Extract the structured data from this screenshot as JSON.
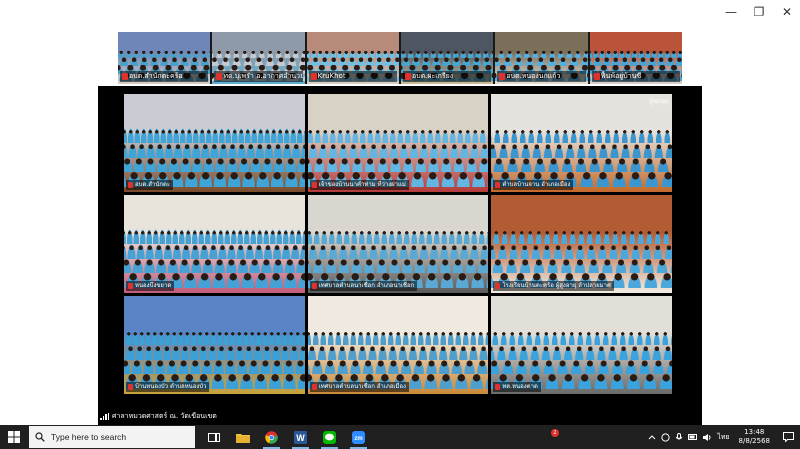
{
  "window": {
    "minimize_glyph": "—",
    "maximize_glyph": "❐",
    "close_glyph": "✕"
  },
  "strip": {
    "thumbs": [
      {
        "name": "อบต.สำนักตะคร้อ",
        "palette": [
          "#6f86b8",
          "#d9d0c4",
          "#4aa0c8"
        ]
      },
      {
        "name": "ทต.บุเพร๋า อ.อากาศอำนวย",
        "palette": [
          "#8f9aa8",
          "#5fb0d5",
          "#c4c9cf"
        ]
      },
      {
        "name": "KruKhot",
        "palette": [
          "#b78a7a",
          "#d8d3c8",
          "#6ec0e4"
        ]
      },
      {
        "name": "อบต.ผะเกรียง",
        "palette": [
          "#4f5663",
          "#cbbf9c",
          "#47a6cf"
        ]
      },
      {
        "name": "อบต.หนองนกแก้ว",
        "palette": [
          "#7b6f5a",
          "#e8e2d6",
          "#54aede"
        ]
      },
      {
        "name": "ฟื้นพ้อยู่บ้านซี",
        "palette": [
          "#b9543a",
          "#d4d4d4",
          "#49a4d4"
        ]
      }
    ]
  },
  "gallery": {
    "corner_label": "ผู้ชุมนุม",
    "tiles": [
      {
        "name": "อบต.สำนักตะ",
        "palette": [
          "#c9ccd2",
          "#7a4b2a",
          "#3fa4d8"
        ]
      },
      {
        "name": "เจ้าของบ้านนาคำท่าม ที่ว่างฝาแม่",
        "palette": [
          "#d8d1c5",
          "#b53a3a",
          "#63b6e2"
        ]
      },
      {
        "name": "ตำบลบ้านจาน อำเภอเมือง",
        "palette": [
          "#e4e2dd",
          "#c3692a",
          "#3b95cf"
        ]
      },
      {
        "name": "หนองบึงขยาด",
        "palette": [
          "#e8e4dc",
          "#c25c7a",
          "#46a2d4"
        ]
      },
      {
        "name": "เทศบาลตำบลนาเชือก อำเภอนาเชือก",
        "palette": [
          "#d9d6cf",
          "#5a5a5a",
          "#5aa9d4"
        ]
      },
      {
        "name": "โรงเรียนบ้านตะคร้อ ผู้สูงอายุ ลำปลายมาศ",
        "palette": [
          "#b35c34",
          "#f1ede4",
          "#4ca7db"
        ]
      },
      {
        "name": "บ้านหนองบัว ตำบลหนองบัว",
        "palette": [
          "#5a84c6",
          "#c8a23c",
          "#3c9fd5"
        ]
      },
      {
        "name": "เทศบาลตำบลนาเชือก อำเภอเมือง",
        "palette": [
          "#efe9df",
          "#c88a3a",
          "#4f9fce"
        ]
      },
      {
        "name": "ทต.หนองตาด",
        "palette": [
          "#e2dfd8",
          "#6a6a6a",
          "#3aa2dc"
        ]
      }
    ],
    "active_speaker": "ศาลาหมวดศาสตร์ ณ. วัดเขือนเขต"
  },
  "taskbar": {
    "search_placeholder": "Type here to search",
    "notify_count": "2",
    "lang": "ไทย",
    "time": "13:48",
    "date": "8/8/2568",
    "colors": {
      "chrome": "#e0312c",
      "word": "#2b5797",
      "line": "#00b900",
      "zoom": "#2d8cff",
      "explorer": "#f0c040"
    }
  }
}
